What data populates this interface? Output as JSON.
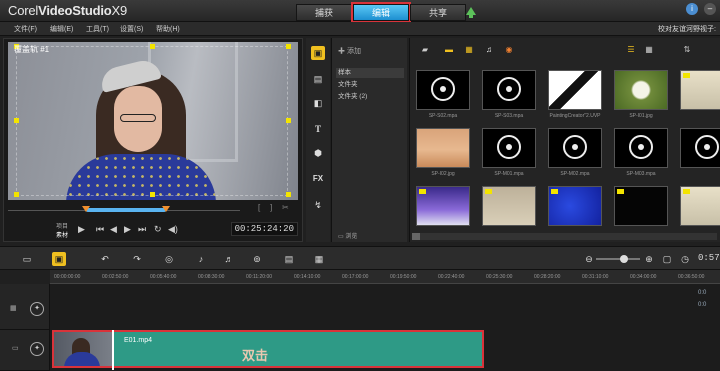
{
  "app": {
    "brand": "Corel",
    "product": "VideoStudio",
    "version": "X9"
  },
  "steps": [
    {
      "label": "捕获"
    },
    {
      "label": "编辑"
    },
    {
      "label": "共享"
    }
  ],
  "menu": [
    {
      "label": "文件(F)"
    },
    {
      "label": "编辑(E)"
    },
    {
      "label": "工具(T)"
    },
    {
      "label": "设置(S)"
    },
    {
      "label": "帮助(H)"
    }
  ],
  "user_text": "校对友谊河野视子:",
  "player": {
    "overlay_label": "覆盖轨 #1",
    "mode_top": "项目",
    "mode_bottom": "素材",
    "timecode": "00:25:24:20"
  },
  "library": {
    "add_label": "添加",
    "folders": [
      {
        "label": "样本"
      },
      {
        "label": "文件夹"
      },
      {
        "label": "文件夹 (2)"
      }
    ],
    "browse_label": "浏览",
    "thumbs": [
      {
        "name": "SP-S02.mpa",
        "kind": "audio"
      },
      {
        "name": "SP-S03.mpa",
        "kind": "audio"
      },
      {
        "name": "PaintingCreator\"2.UVP",
        "kind": "paint"
      },
      {
        "name": "SP-I01.jpg",
        "kind": "dandelion"
      },
      {
        "name": "",
        "kind": "light"
      },
      {
        "name": "SP-I02.jpg",
        "kind": "desert"
      },
      {
        "name": "SP-M01.mpa",
        "kind": "audio"
      },
      {
        "name": "SP-M02.mpa",
        "kind": "audio"
      },
      {
        "name": "SP-M03.mpa",
        "kind": "audio"
      },
      {
        "name": "",
        "kind": "audio"
      },
      {
        "name": "",
        "kind": "purple"
      },
      {
        "name": "",
        "kind": "beige"
      },
      {
        "name": "",
        "kind": "blue"
      },
      {
        "name": "",
        "kind": "black"
      },
      {
        "name": "",
        "kind": "light"
      }
    ]
  },
  "timeline": {
    "timecode": "0:57:5",
    "ruler": [
      "00:00:00:00",
      "00:02:50:00",
      "00:05:40:00",
      "00:08:30:00",
      "00:11:20:00",
      "00:14:10:00",
      "00:17:00:00",
      "00:19:50:00",
      "00:22:40:00",
      "00:25:30:00",
      "00:28:20:00",
      "00:31:10:00",
      "00:34:00:00",
      "00:36:50:00"
    ],
    "clip_name": "E01.mp4",
    "hint": "双击",
    "right_labels": [
      "0:0",
      "0:0"
    ]
  },
  "colors": {
    "accent": "#1d8fd0",
    "highlight": "#d9333a",
    "clip": "#2e9a86",
    "icon_active": "#f0c020"
  }
}
